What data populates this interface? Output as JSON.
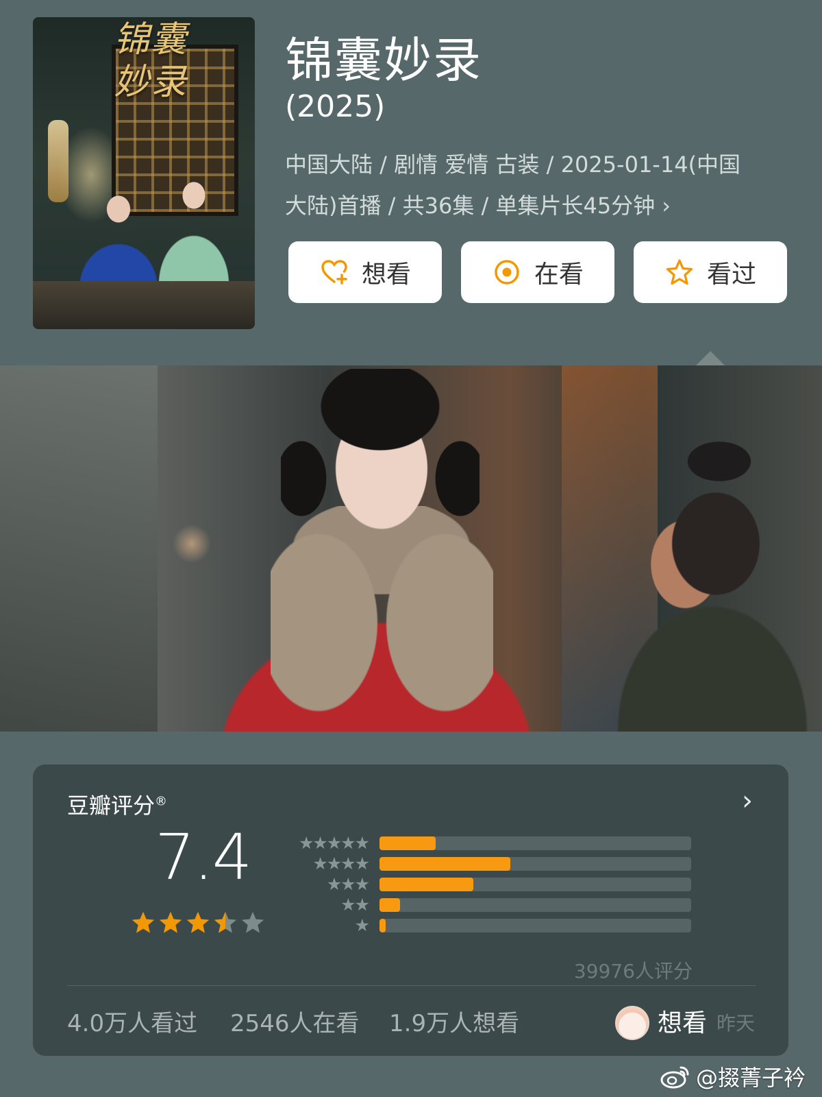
{
  "header": {
    "title": "锦囊妙录",
    "year": "(2025)",
    "meta_line1": "中国大陆 / 剧情 爱情 古装 / 2025-01-14(中国",
    "meta_line2": "大陆)首播 / 共36集 / 单集片长45分钟",
    "meta_more_icon": "chevron-right-icon"
  },
  "poster": {
    "title_art": "锦囊妙录"
  },
  "actions": {
    "want_label": "想看",
    "watching_label": "在看",
    "watched_label": "看过",
    "icons": [
      "heart-plus-icon",
      "radio-dot-icon",
      "star-outline-icon"
    ],
    "icon_color": "#f39800"
  },
  "rating": {
    "title": "豆瓣评分",
    "trademark": "®",
    "score": "7.4",
    "score_star_level": 3.5,
    "max_stars": 5,
    "distribution": [
      {
        "stars": 5,
        "level": 0.18
      },
      {
        "stars": 4,
        "level": 0.42
      },
      {
        "stars": 3,
        "level": 0.3
      },
      {
        "stars": 2,
        "level": 0.065
      },
      {
        "stars": 1,
        "level": 0.02
      }
    ],
    "votes": "39976人评分",
    "stats": [
      "4.0万人看过",
      "2546人在看",
      "1.9万人想看"
    ],
    "my_status": "想看",
    "my_time": "昨天",
    "accent_color": "#f79a12"
  },
  "watermark": {
    "handle": "@掇菁子衿",
    "icon": "weibo-icon"
  }
}
